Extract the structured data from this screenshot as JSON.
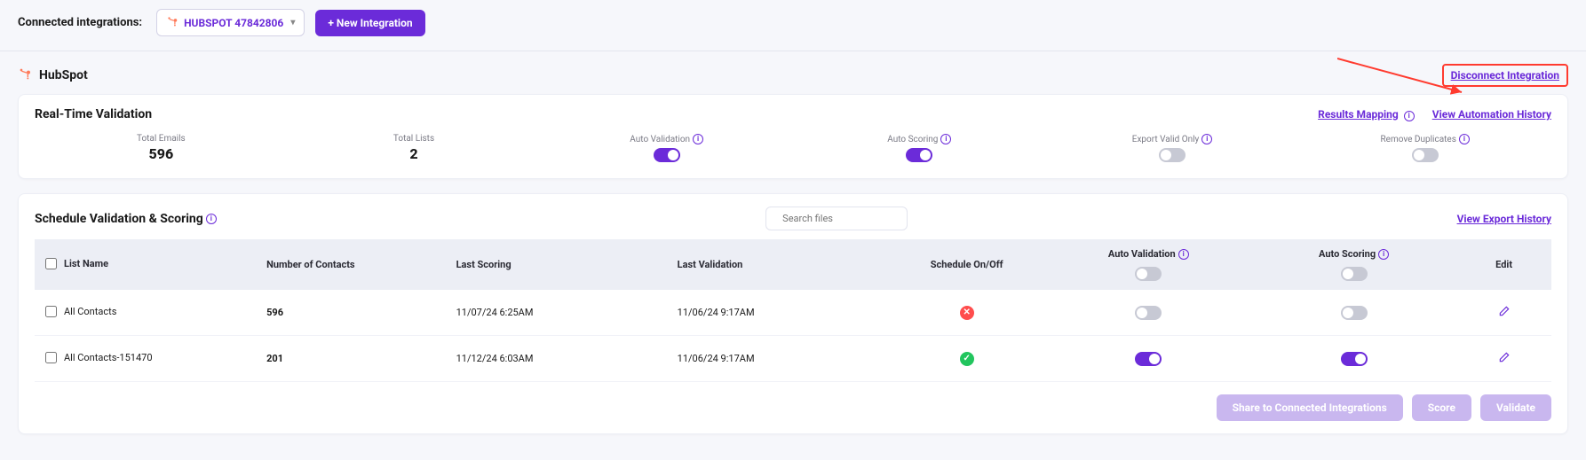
{
  "topbar": {
    "label": "Connected integrations:",
    "chipText": "HUBSPOT 47842806",
    "newIntegration": "+ New Integration"
  },
  "integration": {
    "name": "HubSpot",
    "disconnect": "Disconnect Integration"
  },
  "realtime": {
    "title": "Real-Time Validation",
    "resultsMapping": "Results Mapping",
    "viewAutomation": "View Automation History",
    "metrics": {
      "totalEmailsLabel": "Total Emails",
      "totalEmailsValue": "596",
      "totalListsLabel": "Total Lists",
      "totalListsValue": "2",
      "autoValidationLabel": "Auto Validation",
      "autoValidationOn": true,
      "autoScoringLabel": "Auto Scoring",
      "autoScoringOn": true,
      "exportValidOnlyLabel": "Export Valid Only",
      "exportValidOnlyOn": false,
      "removeDuplicatesLabel": "Remove Duplicates",
      "removeDuplicatesOn": false
    }
  },
  "schedule": {
    "title": "Schedule Validation & Scoring",
    "searchPlaceholder": "Search files",
    "viewExport": "View Export History",
    "columns": {
      "listName": "List Name",
      "contacts": "Number of Contacts",
      "lastScoring": "Last Scoring",
      "lastValidation": "Last Validation",
      "scheduleOnOff": "Schedule On/Off",
      "autoValidation": "Auto Validation",
      "autoScoring": "Auto Scoring",
      "edit": "Edit",
      "headerAutoValidationOn": false,
      "headerAutoScoringOn": false
    },
    "rows": [
      {
        "name": "All Contacts",
        "contacts": "596",
        "lastScoring": "11/07/24 6:25AM",
        "lastValidation": "11/06/24 9:17AM",
        "scheduleOn": false,
        "autoValidationOn": false,
        "autoScoringOn": false
      },
      {
        "name": "All Contacts-151470",
        "contacts": "201",
        "lastScoring": "11/12/24 6:03AM",
        "lastValidation": "11/06/24 9:17AM",
        "scheduleOn": true,
        "autoValidationOn": true,
        "autoScoringOn": true
      }
    ]
  },
  "actions": {
    "share": "Share to Connected Integrations",
    "score": "Score",
    "validate": "Validate"
  },
  "colors": {
    "primary": "#6b2bd9",
    "accent": "#ff7a59",
    "success": "#22c55e",
    "danger": "#ff4d4d"
  }
}
